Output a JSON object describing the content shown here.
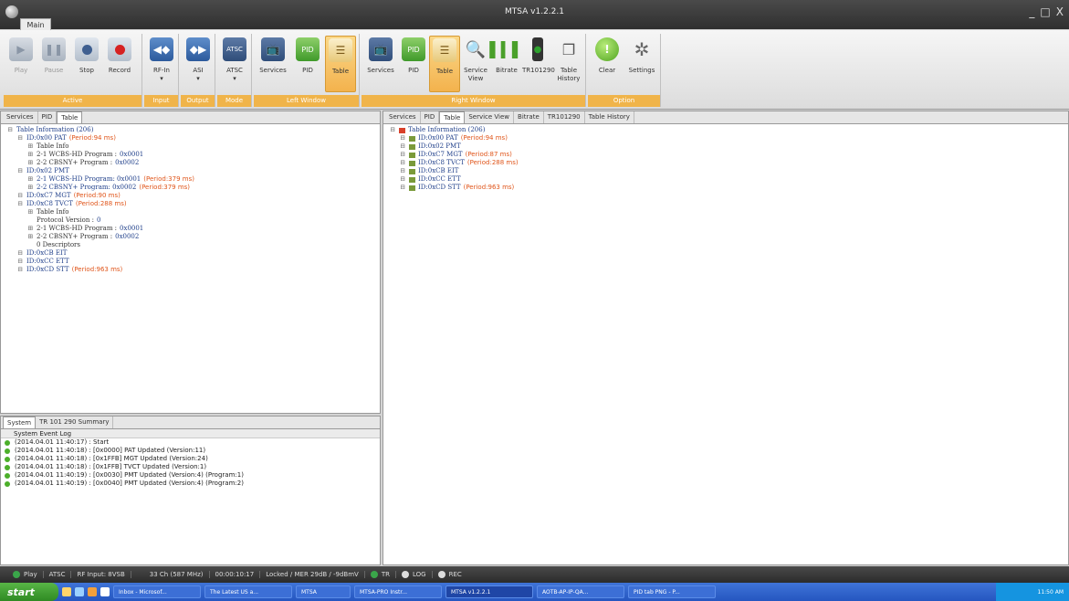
{
  "window": {
    "title": "MTSA v1.2.2.1",
    "controls": [
      "_",
      "□",
      "X"
    ]
  },
  "ribbon": {
    "main_tab": "Main",
    "groups": [
      {
        "label": "Active",
        "buttons": [
          "Play",
          "Pause",
          "Stop",
          "Record"
        ]
      },
      {
        "label": "Input",
        "buttons": [
          "RF-In"
        ]
      },
      {
        "label": "Output",
        "buttons": [
          "ASI"
        ]
      },
      {
        "label": "Mode",
        "buttons": [
          "ATSC"
        ]
      },
      {
        "label": "Left Window",
        "buttons": [
          "Services",
          "PID",
          "Table"
        ]
      },
      {
        "label": "Right Window",
        "buttons": [
          "Services",
          "PID",
          "Table",
          "Service View",
          "Bitrate",
          "TR101290",
          "Table History"
        ]
      },
      {
        "label": "Option",
        "buttons": [
          "Clear",
          "Settings"
        ]
      }
    ]
  },
  "left_tabs": [
    "Services",
    "PID",
    "Table"
  ],
  "left_tree": [
    {
      "indent": 0,
      "text": "Table Information (206)",
      "cls": "t-blue"
    },
    {
      "indent": 1,
      "text": "ID:0x00 PAT",
      "cls": "t-blue",
      "period": "(Period:94 ms)"
    },
    {
      "indent": 2,
      "text": "Table Info",
      "cls": "t-dark"
    },
    {
      "indent": 2,
      "text": "2-1 WCBS-HD Program :",
      "cls": "t-dark",
      "val": "0x0001"
    },
    {
      "indent": 2,
      "text": "2-2 CBSNY+ Program :",
      "cls": "t-dark",
      "val": "0x0002"
    },
    {
      "indent": 1,
      "text": "ID:0x02 PMT",
      "cls": "t-blue"
    },
    {
      "indent": 2,
      "text": "2-1 WCBS-HD Program: 0x0001",
      "cls": "t-blue",
      "period": "(Period:379 ms)"
    },
    {
      "indent": 2,
      "text": "2-2 CBSNY+ Program: 0x0002",
      "cls": "t-blue",
      "period": "(Period:379 ms)"
    },
    {
      "indent": 1,
      "text": "ID:0xC7 MGT",
      "cls": "t-blue",
      "period": "(Period:90 ms)"
    },
    {
      "indent": 1,
      "text": "ID:0xC8 TVCT",
      "cls": "t-blue",
      "period": "(Period:288 ms)"
    },
    {
      "indent": 2,
      "text": "Table Info",
      "cls": "t-dark"
    },
    {
      "indent": 2,
      "text": "Protocol Version :",
      "cls": "t-dark",
      "val": "0"
    },
    {
      "indent": 2,
      "text": "2-1 WCBS-HD Program :",
      "cls": "t-dark",
      "val": "0x0001"
    },
    {
      "indent": 2,
      "text": "2-2 CBSNY+ Program :",
      "cls": "t-dark",
      "val": "0x0002"
    },
    {
      "indent": 2,
      "text": "0 Descriptors",
      "cls": "t-dark"
    },
    {
      "indent": 1,
      "text": "ID:0xCB EIT",
      "cls": "t-blue"
    },
    {
      "indent": 1,
      "text": "ID:0xCC ETT",
      "cls": "t-blue"
    },
    {
      "indent": 1,
      "text": "ID:0xCD STT",
      "cls": "t-blue",
      "period": "(Period:963 ms)"
    }
  ],
  "right_tabs": [
    "Services",
    "PID",
    "Table",
    "Service View",
    "Bitrate",
    "TR101290",
    "Table History"
  ],
  "right_tree": [
    {
      "indent": 0,
      "text": "Table Information (206)",
      "cls": "t-blue"
    },
    {
      "indent": 1,
      "text": "ID:0x00 PAT",
      "cls": "t-blue",
      "period": "(Period:94 ms)"
    },
    {
      "indent": 1,
      "text": "ID:0x02 PMT",
      "cls": "t-blue"
    },
    {
      "indent": 1,
      "text": "ID:0xC7 MGT",
      "cls": "t-blue",
      "period": "(Period:87 ms)"
    },
    {
      "indent": 1,
      "text": "ID:0xC8 TVCT",
      "cls": "t-blue",
      "period": "(Period:288 ms)"
    },
    {
      "indent": 1,
      "text": "ID:0xCB EIT",
      "cls": "t-blue"
    },
    {
      "indent": 1,
      "text": "ID:0xCC ETT",
      "cls": "t-blue"
    },
    {
      "indent": 1,
      "text": "ID:0xCD STT",
      "cls": "t-blue",
      "period": "(Period:963 ms)"
    }
  ],
  "log": {
    "tabs": [
      "System",
      "TR 101 290 Summary"
    ],
    "header": "System Event Log",
    "entries": [
      "(2014.04.01 11:40:17) : Start",
      "(2014.04.01 11:40:18) : [0x0000] PAT Updated (Version:11)",
      "(2014.04.01 11:40:18) : [0x1FFB] MGT Updated (Version:24)",
      "(2014.04.01 11:40:18) : [0x1FFB] TVCT Updated (Version:1)",
      "(2014.04.01 11:40:19) : [0x0030] PMT Updated (Version:4) (Program:1)",
      "(2014.04.01 11:40:19) : [0x0040] PMT Updated (Version:4) (Program:2)"
    ]
  },
  "status": {
    "play": "Play",
    "mode": "ATSC",
    "rf": "RF Input: 8VSB",
    "channel": "33 Ch (587 MHz)",
    "time": "00:00:10:17",
    "lock": "Locked / MER 29dB / -9dBmV",
    "tr": "TR",
    "log": "LOG",
    "rec": "REC"
  },
  "taskbar": {
    "start": "start",
    "tasks": [
      "Inbox - Microsof...",
      "The Latest US a...",
      "MTSA",
      "MTSA-PRO Instr...",
      "MTSA v1.2.2.1",
      "AOTB-AP-IP-QA...",
      "PID tab PNG - P..."
    ],
    "clock": "11:50 AM"
  }
}
